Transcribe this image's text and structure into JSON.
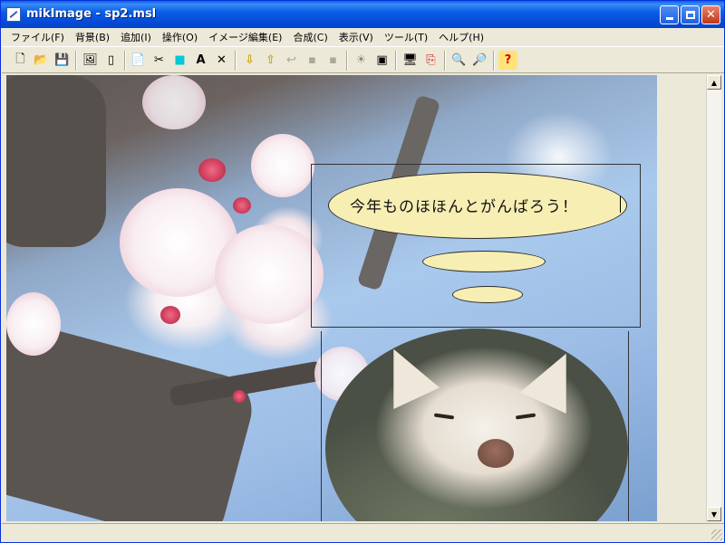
{
  "window": {
    "title": "mikImage - sp2.msl"
  },
  "menubar": {
    "items": [
      "ファイル(F)",
      "背景(B)",
      "追加(I)",
      "操作(O)",
      "イメージ編集(E)",
      "合成(C)",
      "表示(V)",
      "ツール(T)",
      "ヘルプ(H)"
    ]
  },
  "toolbar": {
    "tools": [
      {
        "name": "new-file",
        "glyph": "🗋"
      },
      {
        "name": "open-folder",
        "glyph": "📂"
      },
      {
        "name": "save-disk",
        "glyph": "💾"
      },
      {
        "name": "image",
        "glyph": "🖼"
      },
      {
        "name": "page",
        "glyph": "▯"
      },
      {
        "name": "copy",
        "glyph": "📄"
      },
      {
        "name": "tool",
        "glyph": "✂"
      },
      {
        "name": "color-square",
        "glyph": "■"
      },
      {
        "name": "text-a",
        "glyph": "A"
      },
      {
        "name": "delete-x",
        "glyph": "✕"
      },
      {
        "name": "layer-down",
        "glyph": "⇩"
      },
      {
        "name": "layer-up",
        "glyph": "⇧"
      },
      {
        "name": "undo-arrow",
        "glyph": "↩"
      },
      {
        "name": "disabled-1",
        "glyph": "▪"
      },
      {
        "name": "disabled-2",
        "glyph": "▪"
      },
      {
        "name": "sun",
        "glyph": "☀"
      },
      {
        "name": "frame",
        "glyph": "▣"
      },
      {
        "name": "monitor",
        "glyph": "🖥"
      },
      {
        "name": "export",
        "glyph": "⎘"
      },
      {
        "name": "zoom-in",
        "glyph": "🔍"
      },
      {
        "name": "zoom-out",
        "glyph": "🔎"
      },
      {
        "name": "help",
        "glyph": "?"
      }
    ]
  },
  "canvas": {
    "balloon_text": "今年ものほほんとがんばろう！"
  },
  "colors": {
    "titlebar": "#0a5fe8",
    "balloon": "#f7eeb4",
    "chrome": "#ece9d8"
  }
}
